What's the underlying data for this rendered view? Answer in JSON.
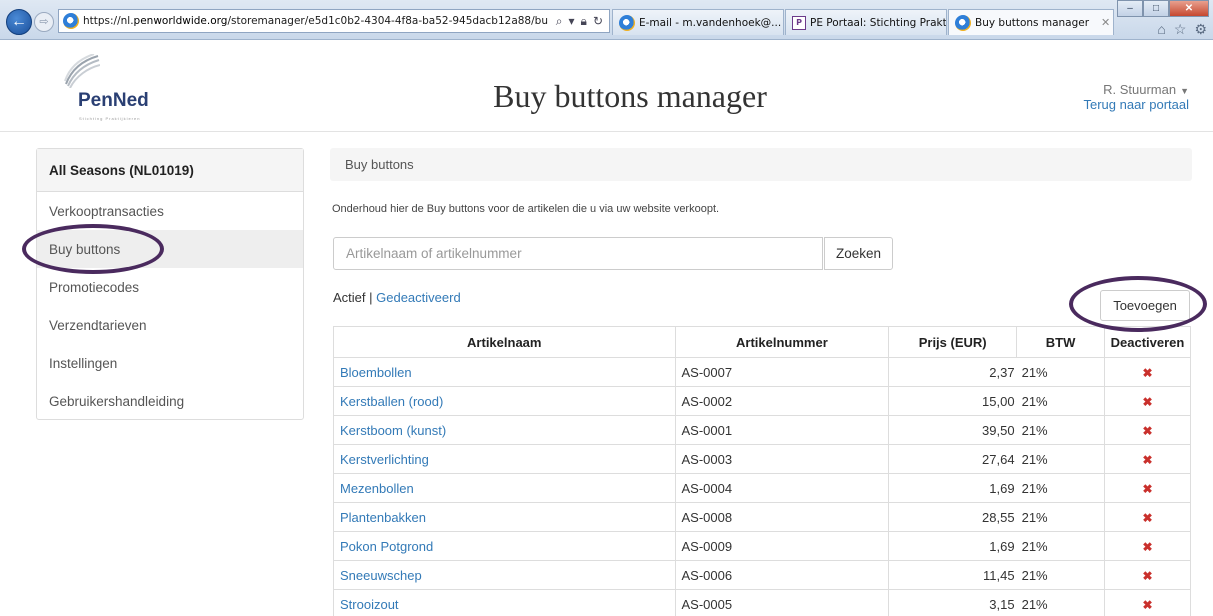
{
  "browser": {
    "url_prefix": "https://nl.",
    "url_domain": "penworldwide.org",
    "url_rest": "/storemanager/e5d1c0b2-4304-4f8a-ba52-945dacb12a88/bu",
    "tabs": [
      {
        "label": "E-mail - m.vandenhoek@...",
        "icon": "ie-icon"
      },
      {
        "label": "PE Portaal: Stichting Prakt...",
        "icon": "pe-icon",
        "icon_text": "P"
      },
      {
        "label": "Buy buttons manager",
        "icon": "ie-icon",
        "active": true
      }
    ]
  },
  "header": {
    "logo_text": "PenNed",
    "logo_tagline": "Stichting Praktijkleren",
    "title": "Buy buttons manager",
    "user": "R. Stuurman",
    "back_link": "Terug naar portaal"
  },
  "sidebar": {
    "heading": "All Seasons (NL01019)",
    "items": [
      {
        "label": "Verkooptransacties"
      },
      {
        "label": "Buy buttons",
        "active": true
      },
      {
        "label": "Promotiecodes"
      },
      {
        "label": "Verzendtarieven"
      },
      {
        "label": "Instellingen"
      },
      {
        "label": "Gebruikershandleiding"
      }
    ]
  },
  "main": {
    "breadcrumb": "Buy buttons",
    "intro": "Onderhoud hier de Buy buttons voor de artikelen die u via uw website verkoopt.",
    "search_placeholder": "Artikelnaam of artikelnummer",
    "search_button": "Zoeken",
    "filter_active": "Actief",
    "filter_separator": " | ",
    "filter_inactive": "Gedeactiveerd",
    "add_button": "Toevoegen"
  },
  "table": {
    "headers": [
      "Artikelnaam",
      "Artikelnummer",
      "Prijs (EUR)",
      "BTW",
      "Deactiveren"
    ],
    "rows": [
      {
        "name": "Bloembollen",
        "number": "AS-0007",
        "price": "2,37",
        "vat": "21%"
      },
      {
        "name": "Kerstballen (rood)",
        "number": "AS-0002",
        "price": "15,00",
        "vat": "21%"
      },
      {
        "name": "Kerstboom (kunst)",
        "number": "AS-0001",
        "price": "39,50",
        "vat": "21%"
      },
      {
        "name": "Kerstverlichting",
        "number": "AS-0003",
        "price": "27,64",
        "vat": "21%"
      },
      {
        "name": "Mezenbollen",
        "number": "AS-0004",
        "price": "1,69",
        "vat": "21%"
      },
      {
        "name": "Plantenbakken",
        "number": "AS-0008",
        "price": "28,55",
        "vat": "21%"
      },
      {
        "name": "Pokon Potgrond",
        "number": "AS-0009",
        "price": "1,69",
        "vat": "21%"
      },
      {
        "name": "Sneeuwschep",
        "number": "AS-0006",
        "price": "11,45",
        "vat": "21%"
      },
      {
        "name": "Strooizout",
        "number": "AS-0005",
        "price": "3,15",
        "vat": "21%"
      }
    ],
    "delete_icon": "close-icon",
    "delete_color": "#c9302c"
  },
  "colors": {
    "link": "#337ab7",
    "annotation": "#4a2a5e"
  }
}
